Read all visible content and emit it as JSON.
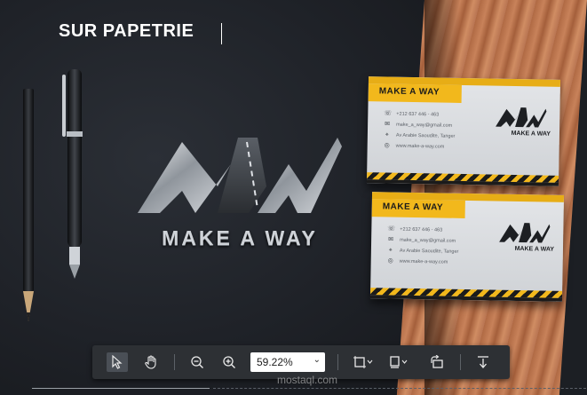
{
  "page_title": "SUR PAPETRIE",
  "logo": {
    "brand_text": "MAKE A WAY"
  },
  "cards": [
    {
      "header_label": "MAKE A WAY",
      "brand_text": "MAKE A WAY",
      "info": [
        {
          "icon": "phone-icon",
          "text": "+212 637 446 - 463"
        },
        {
          "icon": "email-icon",
          "text": "make_a_way@gmail.com"
        },
        {
          "icon": "location-icon",
          "text": "Av Arabie Saoudite, Tanger"
        },
        {
          "icon": "globe-icon",
          "text": "www.make-a-way.com"
        }
      ]
    },
    {
      "header_label": "MAKE A WAY",
      "brand_text": "MAKE A WAY",
      "info": [
        {
          "icon": "phone-icon",
          "text": "+212 637 446 - 463"
        },
        {
          "icon": "email-icon",
          "text": "make_a_way@gmail.com"
        },
        {
          "icon": "location-icon",
          "text": "Av Arabie Saoudite, Tanger"
        },
        {
          "icon": "globe-icon",
          "text": "www.make-a-way.com"
        }
      ]
    }
  ],
  "toolbar": {
    "zoom_value": "59.22%",
    "tools": [
      "select-tool",
      "hand-tool",
      "zoom-out",
      "zoom-in",
      "crop-tool",
      "page-tool",
      "rotate-tool",
      "download-tool"
    ]
  },
  "watermark": "mostaql.com",
  "colors": {
    "accent": "#f2b81c",
    "toolbar_bg": "#2d3034",
    "paper": "#1f2228"
  }
}
